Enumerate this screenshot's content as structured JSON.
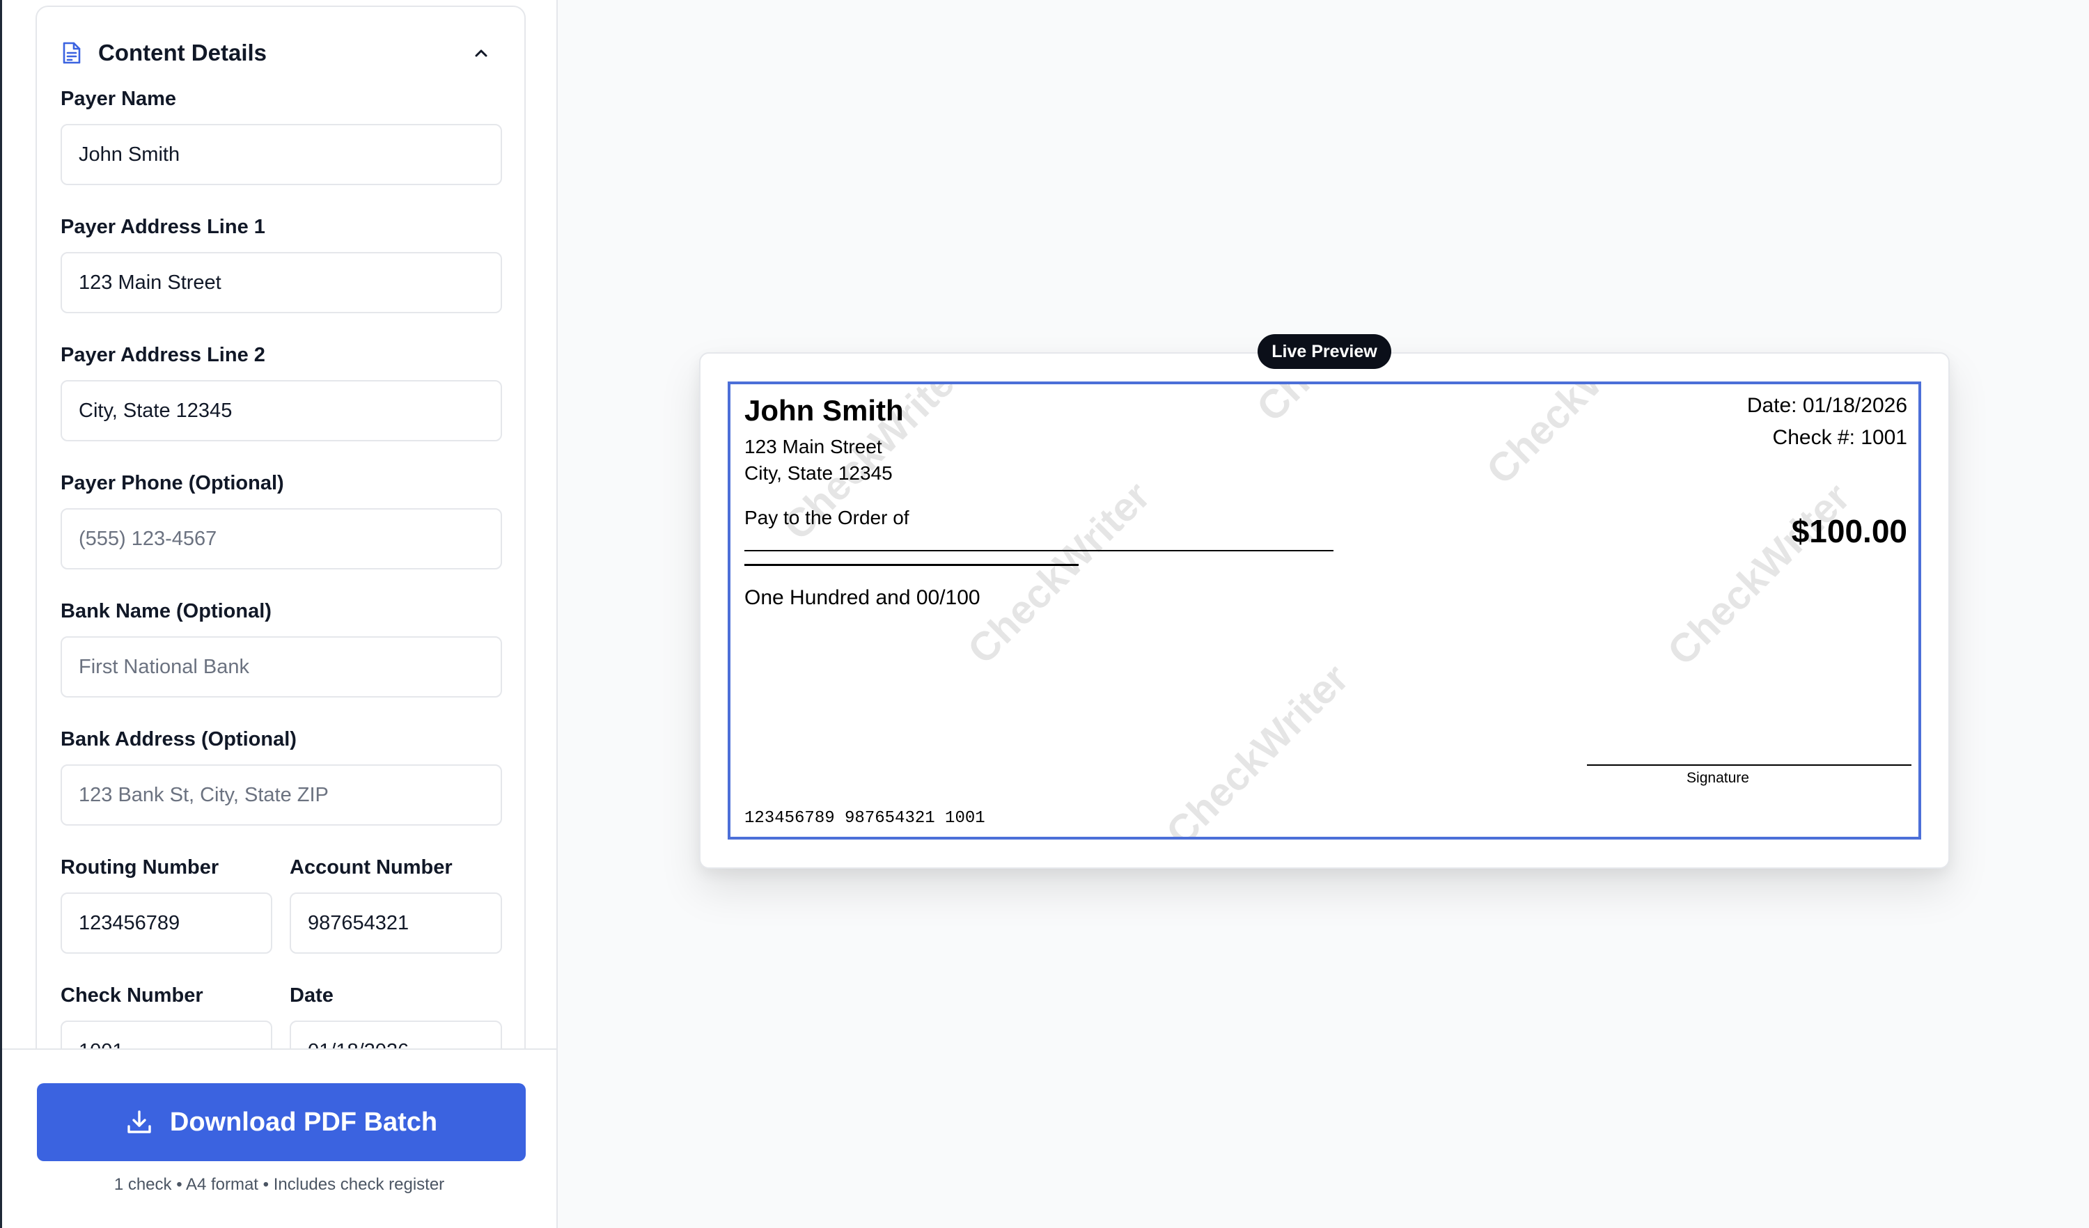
{
  "content_details": {
    "title": "Content Details",
    "fields": {
      "payer_name": {
        "label": "Payer Name",
        "value": "John Smith"
      },
      "payer_address1": {
        "label": "Payer Address Line 1",
        "value": "123 Main Street"
      },
      "payer_address2": {
        "label": "Payer Address Line 2",
        "value": "City, State 12345"
      },
      "payer_phone": {
        "label": "Payer Phone (Optional)",
        "placeholder": "(555) 123-4567"
      },
      "bank_name": {
        "label": "Bank Name (Optional)",
        "placeholder": "First National Bank"
      },
      "bank_address": {
        "label": "Bank Address (Optional)",
        "placeholder": "123 Bank St, City, State ZIP"
      },
      "routing_number": {
        "label": "Routing Number",
        "value": "123456789"
      },
      "account_number": {
        "label": "Account Number",
        "value": "987654321"
      },
      "check_number": {
        "label": "Check Number",
        "value": "1001"
      },
      "date": {
        "label": "Date",
        "value": "01/18/2026"
      }
    }
  },
  "footer": {
    "download_label": "Download PDF Batch",
    "note": "1 check • A4 format • Includes check register"
  },
  "preview": {
    "badge": "Live Preview",
    "watermark": "CheckWriter",
    "check": {
      "payer_name": "John Smith",
      "payer_address1": "123 Main Street",
      "payer_address2": "City, State 12345",
      "date": "Date: 01/18/2026",
      "check_number": "Check #: 1001",
      "pay_to_label": "Pay to the Order of",
      "amount": "$100.00",
      "amount_words": "One Hundred and 00/100",
      "signature_label": "Signature",
      "micr": "123456789 987654321 1001"
    }
  },
  "colors": {
    "accent": "#3b63e0",
    "check_border": "#4c6fd8",
    "badge_bg": "#0b0f19"
  }
}
